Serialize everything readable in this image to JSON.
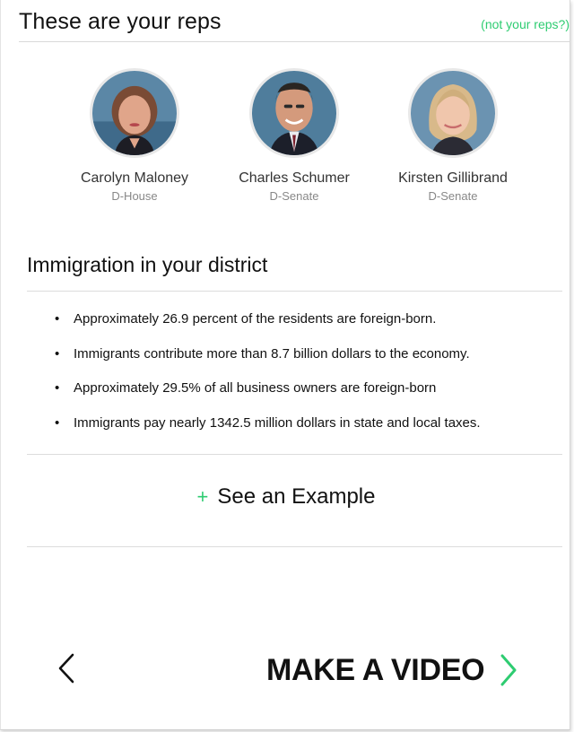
{
  "header": {
    "title": "These are your reps",
    "not_your_reps": "(not your reps?)"
  },
  "reps": [
    {
      "name": "Carolyn Maloney",
      "party": "D-House"
    },
    {
      "name": "Charles Schumer",
      "party": "D-Senate"
    },
    {
      "name": "Kirsten Gillibrand",
      "party": "D-Senate"
    }
  ],
  "district": {
    "title": "Immigration in your district",
    "facts": [
      "Approximately 26.9 percent of the residents are foreign-born.",
      "Immigrants contribute more than 8.7 billion dollars to the economy.",
      "Approximately 29.5% of all business owners are foreign-born",
      "Immigrants pay nearly 1342.5 million dollars in state and local taxes."
    ]
  },
  "example": {
    "plus": "+",
    "label": "See an Example"
  },
  "footer": {
    "cta_label": "MAKE A VIDEO"
  },
  "colors": {
    "accent": "#2ecc71",
    "text": "#111111",
    "muted": "#888888"
  }
}
